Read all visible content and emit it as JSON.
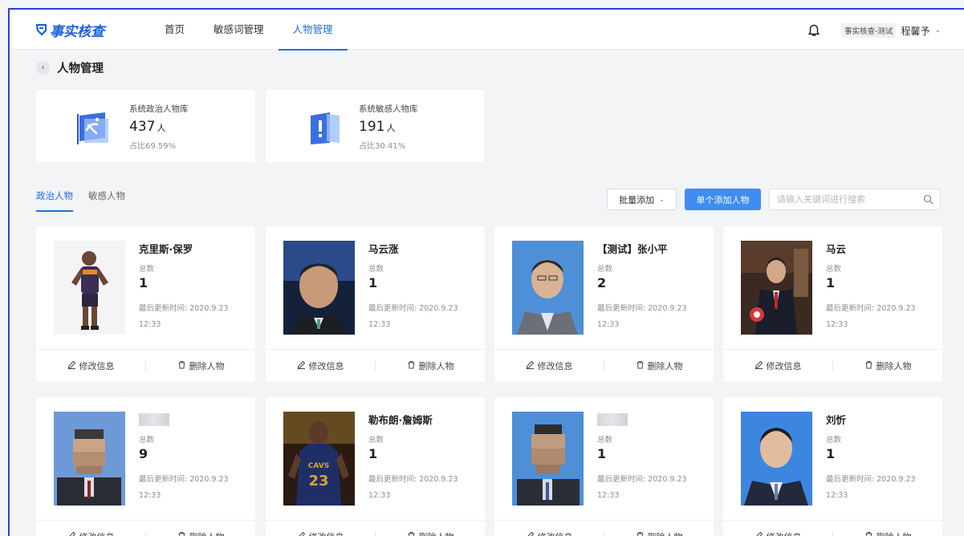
{
  "header": {
    "logo_text": "事实核查",
    "nav": [
      {
        "label": "首页",
        "active": false
      },
      {
        "label": "敏感词管理",
        "active": false
      },
      {
        "label": "人物管理",
        "active": true
      }
    ],
    "user_tag": "事实核查-测试",
    "user_name": "程馨予",
    "user_caret": "⌄"
  },
  "page": {
    "title": "人物管理",
    "back_icon": "‹"
  },
  "stats": [
    {
      "label": "系统政治人物库",
      "count": "437",
      "unit": "人",
      "ratio": "占比69.59%",
      "icon": "party-flag-icon"
    },
    {
      "label": "系统敏感人物库",
      "count": "191",
      "unit": "人",
      "ratio": "占比30.41%",
      "icon": "warning-book-icon"
    }
  ],
  "tabs": [
    {
      "label": "政治人物",
      "active": true
    },
    {
      "label": "敏感人物",
      "active": false
    }
  ],
  "toolbar": {
    "batch_label": "批量添加",
    "batch_caret": "⌄",
    "add_label": "单个添加人物",
    "search_placeholder": "请输入关键词进行搜索"
  },
  "card_labels": {
    "total_label": "总数",
    "edit_label": "修改信息",
    "delete_label": "删除人物"
  },
  "persons": [
    {
      "name": "克里斯·保罗",
      "total": "1",
      "updated": "最后更新时间: 2020.9.23 12:33",
      "photo": "athlete-suns"
    },
    {
      "name": "马云涨",
      "total": "1",
      "updated": "最后更新时间: 2020.9.23 12:33",
      "photo": "man-dark-bg"
    },
    {
      "name": "【测试】张小平",
      "total": "2",
      "updated": "最后更新时间: 2020.9.23 12:33",
      "photo": "man-blue-bg"
    },
    {
      "name": "马云",
      "total": "1",
      "updated": "最后更新时间: 2020.9.23 12:33",
      "photo": "man-suit-hall"
    },
    {
      "name": "",
      "total": "9",
      "updated": "最后更新时间: 2020.9.23 12:33",
      "photo": "man-blurred",
      "name_blurred": true
    },
    {
      "name": "勒布朗·詹姆斯",
      "total": "1",
      "updated": "最后更新时间: 2020.9.23 12:33",
      "photo": "athlete-cavs"
    },
    {
      "name": "",
      "total": "1",
      "updated": "最后更新时间: 2020.9.23 12:33",
      "photo": "man-blurred-2",
      "name_blurred": true
    },
    {
      "name": "刘忻",
      "total": "1",
      "updated": "最后更新时间: 2020.9.23 12:33",
      "photo": "man-blue-bg-2"
    }
  ],
  "colors": {
    "accent": "#1f6fe0",
    "primary_button": "#3f8cf3",
    "background": "#f3f4f6"
  }
}
